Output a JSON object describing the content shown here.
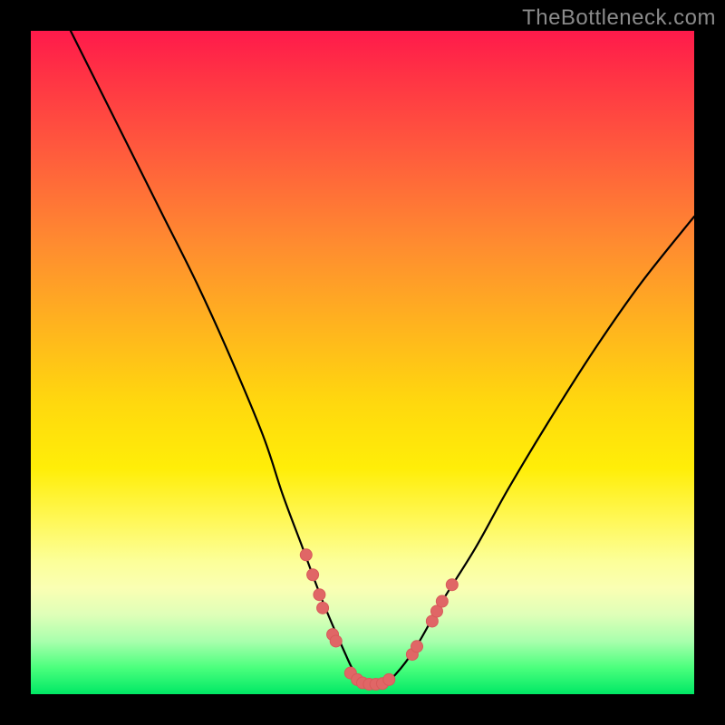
{
  "watermark": "TheBottleneck.com",
  "chart_data": {
    "type": "line",
    "title": "",
    "xlabel": "",
    "ylabel": "",
    "xlim": [
      0,
      100
    ],
    "ylim": [
      0,
      100
    ],
    "series": [
      {
        "name": "bottleneck-curve",
        "x": [
          6,
          10,
          15,
          20,
          25,
          30,
          35,
          38,
          41,
          44,
          47,
          49,
          51,
          53,
          55,
          58,
          62,
          67,
          72,
          78,
          85,
          92,
          100
        ],
        "y": [
          100,
          92,
          82,
          72,
          62,
          51,
          39,
          30,
          22,
          14,
          7,
          3,
          1.5,
          1.5,
          3,
          7,
          14,
          22,
          31,
          41,
          52,
          62,
          72
        ]
      }
    ],
    "markers": {
      "name": "threshold-dots",
      "points": [
        {
          "x": 41.5,
          "y": 21
        },
        {
          "x": 42.5,
          "y": 18
        },
        {
          "x": 43.5,
          "y": 15
        },
        {
          "x": 44.0,
          "y": 13
        },
        {
          "x": 45.5,
          "y": 9
        },
        {
          "x": 46.0,
          "y": 8
        },
        {
          "x": 48.2,
          "y": 3.2
        },
        {
          "x": 49.2,
          "y": 2.2
        },
        {
          "x": 50.0,
          "y": 1.7
        },
        {
          "x": 51.0,
          "y": 1.5
        },
        {
          "x": 52.0,
          "y": 1.5
        },
        {
          "x": 53.0,
          "y": 1.6
        },
        {
          "x": 54.0,
          "y": 2.2
        },
        {
          "x": 57.5,
          "y": 6
        },
        {
          "x": 58.2,
          "y": 7.2
        },
        {
          "x": 60.5,
          "y": 11
        },
        {
          "x": 61.2,
          "y": 12.5
        },
        {
          "x": 62.0,
          "y": 14
        },
        {
          "x": 63.5,
          "y": 16.5
        }
      ]
    },
    "colors": {
      "curve": "#000000",
      "marker": "#e06666",
      "gradient_top": "#ff1a4b",
      "gradient_bottom": "#00e865"
    }
  }
}
